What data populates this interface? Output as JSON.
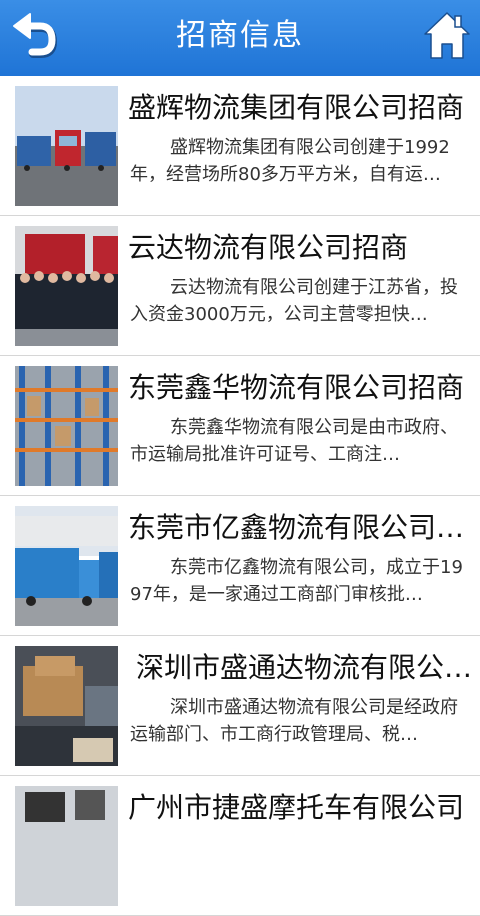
{
  "header": {
    "title": "招商信息",
    "back_icon": "back-arrow-icon",
    "home_icon": "home-icon",
    "color": "#2a82e0"
  },
  "items": [
    {
      "title": "盛辉物流集团有限公司招商",
      "desc": "盛辉物流集团有限公司创建于1992年，经营场所80多万平方米，自有运…",
      "image": "trucks-photo"
    },
    {
      "title": "云达物流有限公司招商",
      "desc": "云达物流有限公司创建于江苏省，投入资金3000万元，公司主营零担快…",
      "image": "team-photo"
    },
    {
      "title": "东莞鑫华物流有限公司招商",
      "desc": "东莞鑫华物流有限公司是由市政府、市运输局批准许可证号、工商注…",
      "image": "warehouse-photo"
    },
    {
      "title": "东莞市亿鑫物流有限公司…",
      "desc": "东莞市亿鑫物流有限公司，成立于1997年，是一家通过工商部门审核批…",
      "image": "blue-trucks-photo"
    },
    {
      "title": "深圳市盛通达物流有限公…",
      "desc": "深圳市盛通达物流有限公司是经政府运输部门、市工商行政管理局、税…",
      "image": "loading-photo"
    },
    {
      "title": "广州市捷盛摩托车有限公司",
      "desc": "",
      "image": "motorbike-photo"
    }
  ]
}
